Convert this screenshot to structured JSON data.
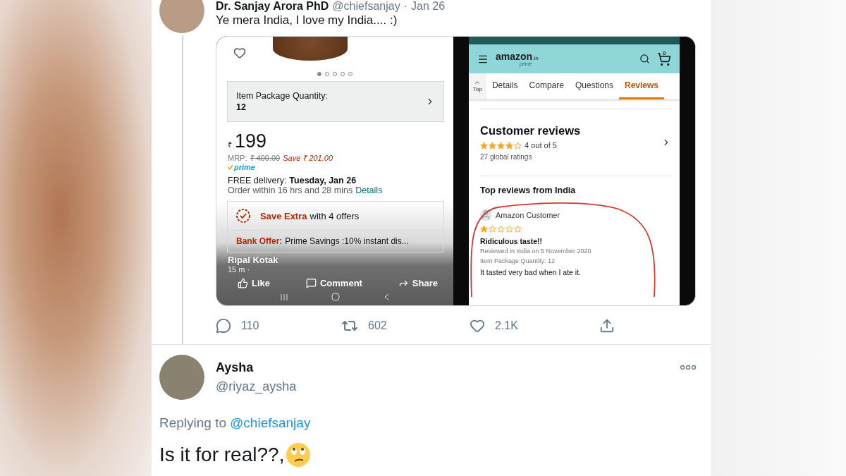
{
  "tweet": {
    "author": "Dr. Sanjay Arora PhD",
    "handle": "@chiefsanjay",
    "separator": "·",
    "date": "Jan 26",
    "text": "Ye mera India, I love my India.... :)",
    "media": {
      "product_page": {
        "carousel": [
          {
            "selected": true
          },
          {
            "selected": false
          },
          {
            "selected": false
          },
          {
            "selected": false
          },
          {
            "selected": false
          }
        ],
        "quantity_label": "Item Package Quantity:",
        "quantity_value": "12",
        "currency": "₹",
        "price": "199",
        "mrp_label": "MRP:",
        "mrp": "₹ 400.00",
        "saving": "Save ₹ 201.00",
        "prime": "prime",
        "delivery_label": "FREE delivery:",
        "delivery_date": "Tuesday, Jan 26",
        "order_note": "Order within 16 hrs and 28 mins",
        "order_link": "Details",
        "offers_title": "Save Extra",
        "offers_rest": "with 4 offers",
        "bank_label": "Bank Offer:",
        "bank_text": "Prime Savings :10% instant dis...",
        "video_overlay": {
          "author": "Ripal Kotak",
          "age": "15 m ·",
          "actions": [
            {
              "kind": "like",
              "label": "Like"
            },
            {
              "kind": "comment",
              "label": "Comment"
            },
            {
              "kind": "share",
              "label": "Share"
            }
          ]
        }
      },
      "reviews_page": {
        "logo": "amazon",
        "logo_domain": ".in",
        "logo_sub": "prime",
        "cart_count": "0",
        "tabs": [
          {
            "kind": "top",
            "label": "Top",
            "selected": false
          },
          {
            "kind": "section",
            "label": "Details",
            "selected": false
          },
          {
            "kind": "section",
            "label": "Compare",
            "selected": false
          },
          {
            "kind": "section",
            "label": "Questions",
            "selected": false
          },
          {
            "kind": "section",
            "label": "Reviews",
            "selected": true
          }
        ],
        "heading": "Customer reviews",
        "stars": 4,
        "rating": "4 out of 5",
        "ratings_count": "27 global ratings",
        "top_heading": "Top reviews from India",
        "review": {
          "author": "Amazon Customer",
          "stars": 1,
          "title": "Ridiculous taste!!",
          "meta": "Reviewed in India on 5 November 2020",
          "variant": "Item Package Quantity: 12",
          "body": "It tasted very bad when I ate it."
        }
      }
    },
    "actions": [
      {
        "kind": "reply",
        "count": "110"
      },
      {
        "kind": "retweet",
        "count": "602"
      },
      {
        "kind": "like",
        "count": "2.1K"
      },
      {
        "kind": "share"
      }
    ]
  },
  "reply": {
    "author": "Aysha",
    "handle": "@riyaz_aysha",
    "replying_prefix": "Replying to",
    "replying_handle": "@chiefsanjay",
    "text": "Is it for real??,"
  }
}
